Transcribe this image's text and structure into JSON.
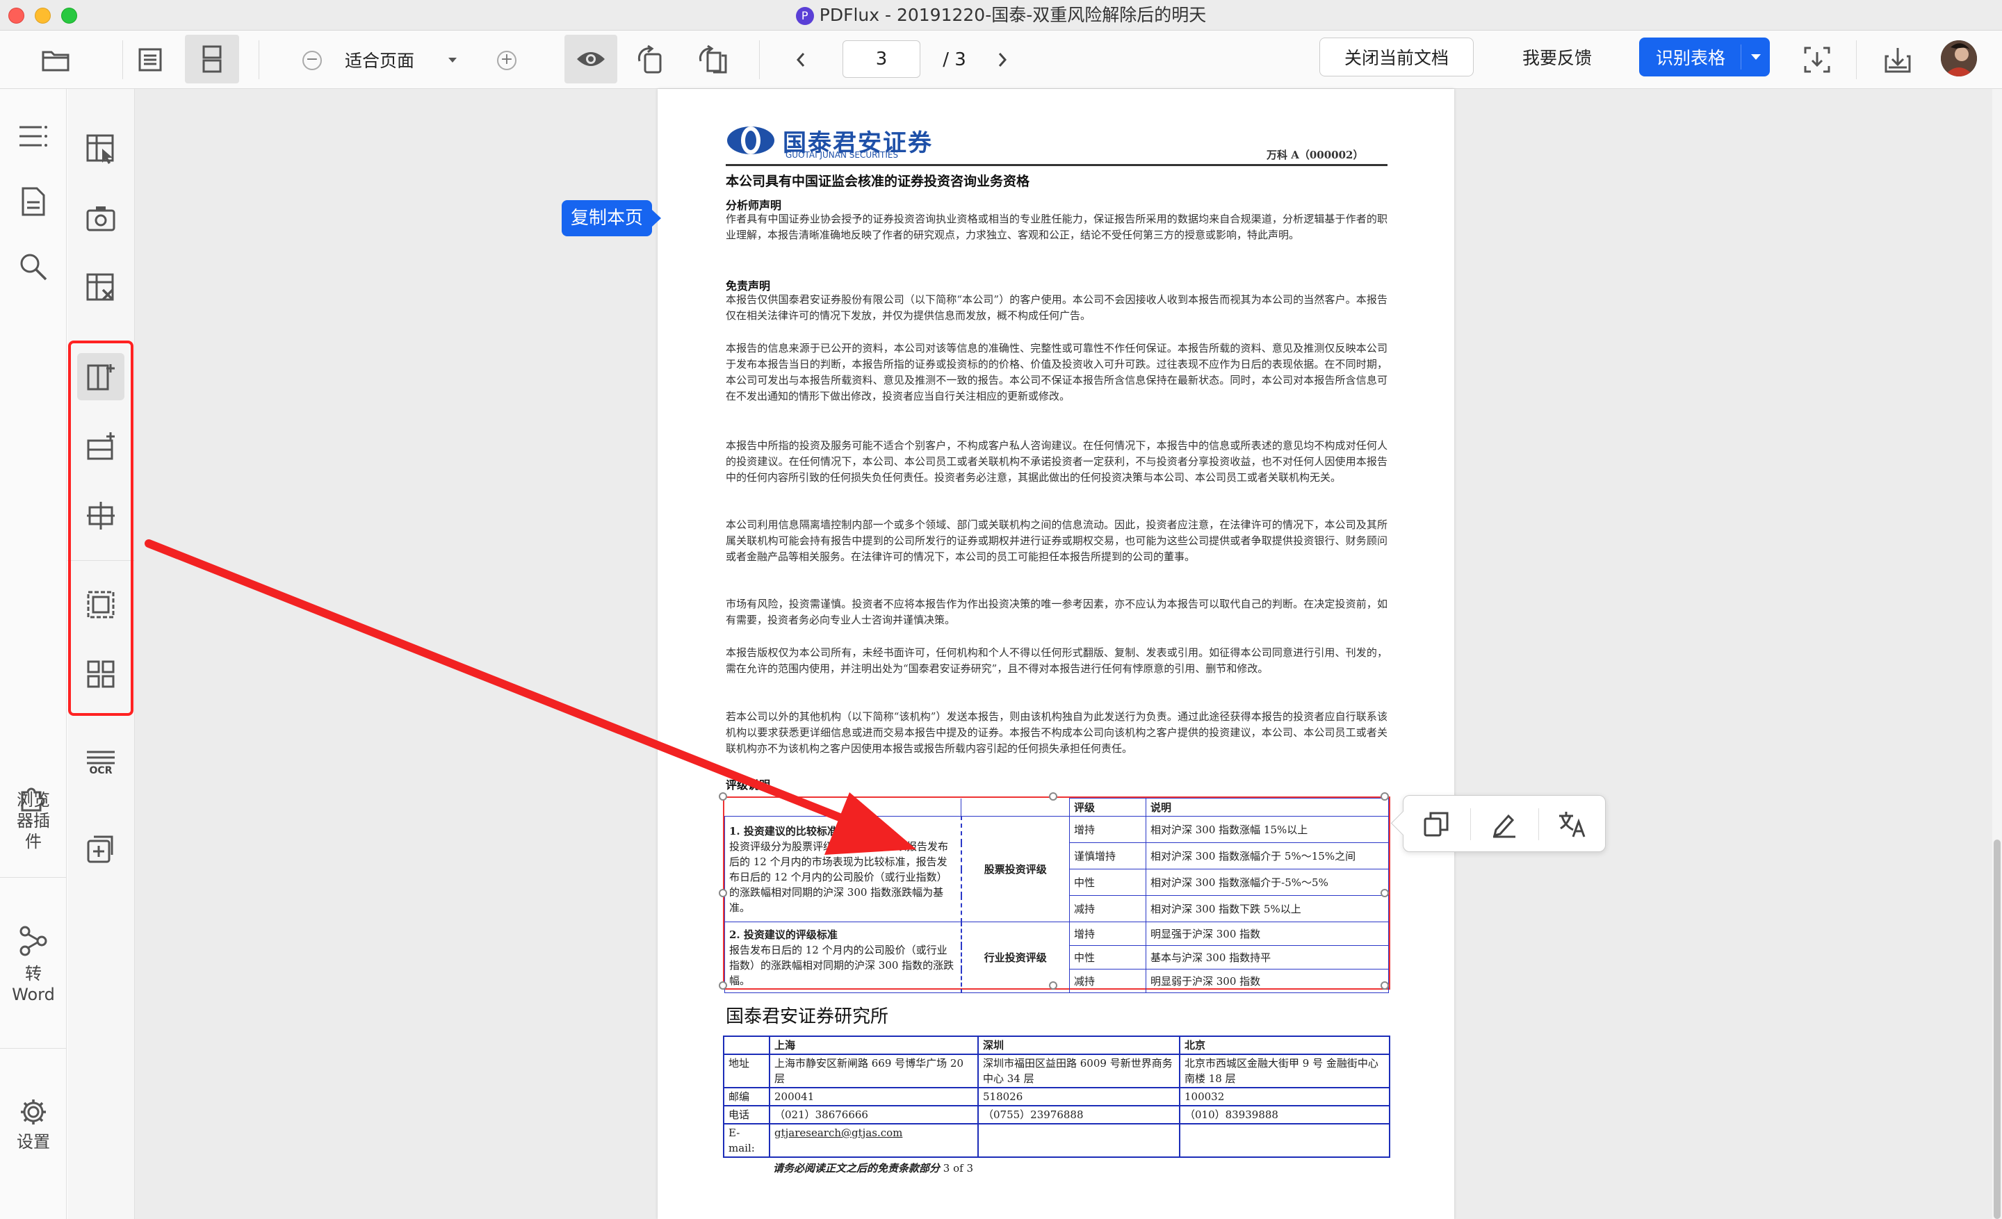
{
  "window": {
    "title": "PDFlux - 20191220-国泰-双重风险解除后的明天",
    "app_logo_letter": "P"
  },
  "colors": {
    "accent": "#1765f0",
    "annotation_red": "#f22222",
    "table_border": "#1c2db8"
  },
  "toolbar": {
    "zoom_label": "适合页面",
    "page_current": "3",
    "page_total": "/ 3",
    "close_doc": "关闭当前文档",
    "feedback": "我要反馈",
    "recognize_table": "识别表格"
  },
  "nav": {
    "browser_plugin": "浏览器插件",
    "to_word_1": "转",
    "to_word_2": "Word",
    "settings": "设置"
  },
  "tools": {
    "ocr_badge": "OCR"
  },
  "popups": {
    "copy_page": "复制本页"
  },
  "doc": {
    "brand_cn": "国泰君安证券",
    "brand_en": "GUOTAI JUNAN SECURITIES",
    "stock": "万科 A（000002）",
    "qualification": "本公司具有中国证监会核准的证券投资咨询业务资格",
    "analyst_title": "分析师声明",
    "analyst_body": "作者具有中国证券业协会授予的证券投资咨询执业资格或相当的专业胜任能力，保证报告所采用的数据均来自合规渠道，分析逻辑基于作者的职业理解，本报告清晰准确地反映了作者的研究观点，力求独立、客观和公正，结论不受任何第三方的授意或影响，特此声明。",
    "disclaimer_title": "免责声明",
    "disclaimer_paras": [
      "本报告仅供国泰君安证券股份有限公司（以下简称“本公司”）的客户使用。本公司不会因接收人收到本报告而视其为本公司的当然客户。本报告仅在相关法律许可的情况下发放，并仅为提供信息而发放，概不构成任何广告。",
      "本报告的信息来源于已公开的资料，本公司对该等信息的准确性、完整性或可靠性不作任何保证。本报告所载的资料、意见及推测仅反映本公司于发布本报告当日的判断，本报告所指的证券或投资标的的价格、价值及投资收入可升可跌。过往表现不应作为日后的表现依据。在不同时期，本公司可发出与本报告所载资料、意见及推测不一致的报告。本公司不保证本报告所含信息保持在最新状态。同时，本公司对本报告所含信息可在不发出通知的情形下做出修改，投资者应当自行关注相应的更新或修改。",
      "本报告中所指的投资及服务可能不适合个别客户，不构成客户私人咨询建议。在任何情况下，本报告中的信息或所表述的意见均不构成对任何人的投资建议。在任何情况下，本公司、本公司员工或者关联机构不承诺投资者一定获利，不与投资者分享投资收益，也不对任何人因使用本报告中的任何内容所引致的任何损失负任何责任。投资者务必注意，其据此做出的任何投资决策与本公司、本公司员工或者关联机构无关。",
      "本公司利用信息隔离墙控制内部一个或多个领域、部门或关联机构之间的信息流动。因此，投资者应注意，在法律许可的情况下，本公司及其所属关联机构可能会持有报告中提到的公司所发行的证券或期权并进行证券或期权交易，也可能为这些公司提供或者争取提供投资银行、财务顾问或者金融产品等相关服务。在法律许可的情况下，本公司的员工可能担任本报告所提到的公司的董事。",
      "市场有风险，投资需谨慎。投资者不应将本报告作为作出投资决策的唯一参考因素，亦不应认为本报告可以取代自己的判断。在决定投资前，如有需要，投资者务必向专业人士咨询并谨慎决策。",
      "本报告版权仅为本公司所有，未经书面许可，任何机构和个人不得以任何形式翻版、复制、发表或引用。如征得本公司同意进行引用、刊发的，需在允许的范围内使用，并注明出处为“国泰君安证券研究”，且不得对本报告进行任何有悖原意的引用、删节和修改。",
      "若本公司以外的其他机构（以下简称“该机构”）发送本报告，则由该机构独自为此发送行为负责。通过此途径获得本报告的投资者应自行联系该机构以要求获悉更详细信息或进而交易本报告中提及的证券。本报告不构成本公司向该机构之客户提供的投资建议，本公司、本公司员工或者关联机构亦不为该机构之客户因使用本报告或报告所载内容引起的任何损失承担任何责任。"
    ],
    "rating_title": "评级说明",
    "rating_table": {
      "h_rating": "评级",
      "h_desc": "说明",
      "left1_title": "1. 投资建议的比较标准",
      "left1_body": "投资评级分为股票评级和行业评级。以报告发布后的 12 个月内的市场表现为比较标准，报告发布日后的 12 个月内的公司股价（或行业指数）的涨跌幅相对同期的沪深 300 指数涨跌幅为基准。",
      "left2_title": "2. 投资建议的评级标准",
      "left2_body": "报告发布日后的 12 个月内的公司股价（或行业指数）的涨跌幅相对同期的沪深 300 指数的涨跌幅。",
      "stock_label": "股票投资评级",
      "industry_label": "行业投资评级",
      "stock_rows": [
        [
          "增持",
          "相对沪深 300 指数涨幅 15%以上"
        ],
        [
          "谨慎增持",
          "相对沪深 300 指数涨幅介于 5%～15%之间"
        ],
        [
          "中性",
          "相对沪深 300 指数涨幅介于-5%～5%"
        ],
        [
          "减持",
          "相对沪深 300 指数下跌 5%以上"
        ]
      ],
      "industry_rows": [
        [
          "增持",
          "明显强于沪深 300 指数"
        ],
        [
          "中性",
          "基本与沪深 300 指数持平"
        ],
        [
          "减持",
          "明显弱于沪深 300 指数"
        ]
      ]
    },
    "institute": "国泰君安证券研究所",
    "addr_table": {
      "headers": [
        "",
        "上海",
        "深圳",
        "北京"
      ],
      "rows": [
        [
          "地址",
          "上海市静安区新闸路 669 号博华广场 20 层",
          "深圳市福田区益田路 6009 号新世界商务中心 34 层",
          "北京市西城区金融大街甲 9 号 金融街中心南楼 18 层"
        ],
        [
          "邮编",
          "200041",
          "518026",
          "100032"
        ],
        [
          "电话",
          "（021）38676666",
          "（0755）23976888",
          "（010）83939888"
        ],
        [
          "E-mail:",
          "gtjaresearch@gtjas.com",
          "",
          ""
        ]
      ]
    },
    "footer_italic": "请务必阅读正文之后的免责条款部分",
    "footer_page": "3 of 3"
  }
}
